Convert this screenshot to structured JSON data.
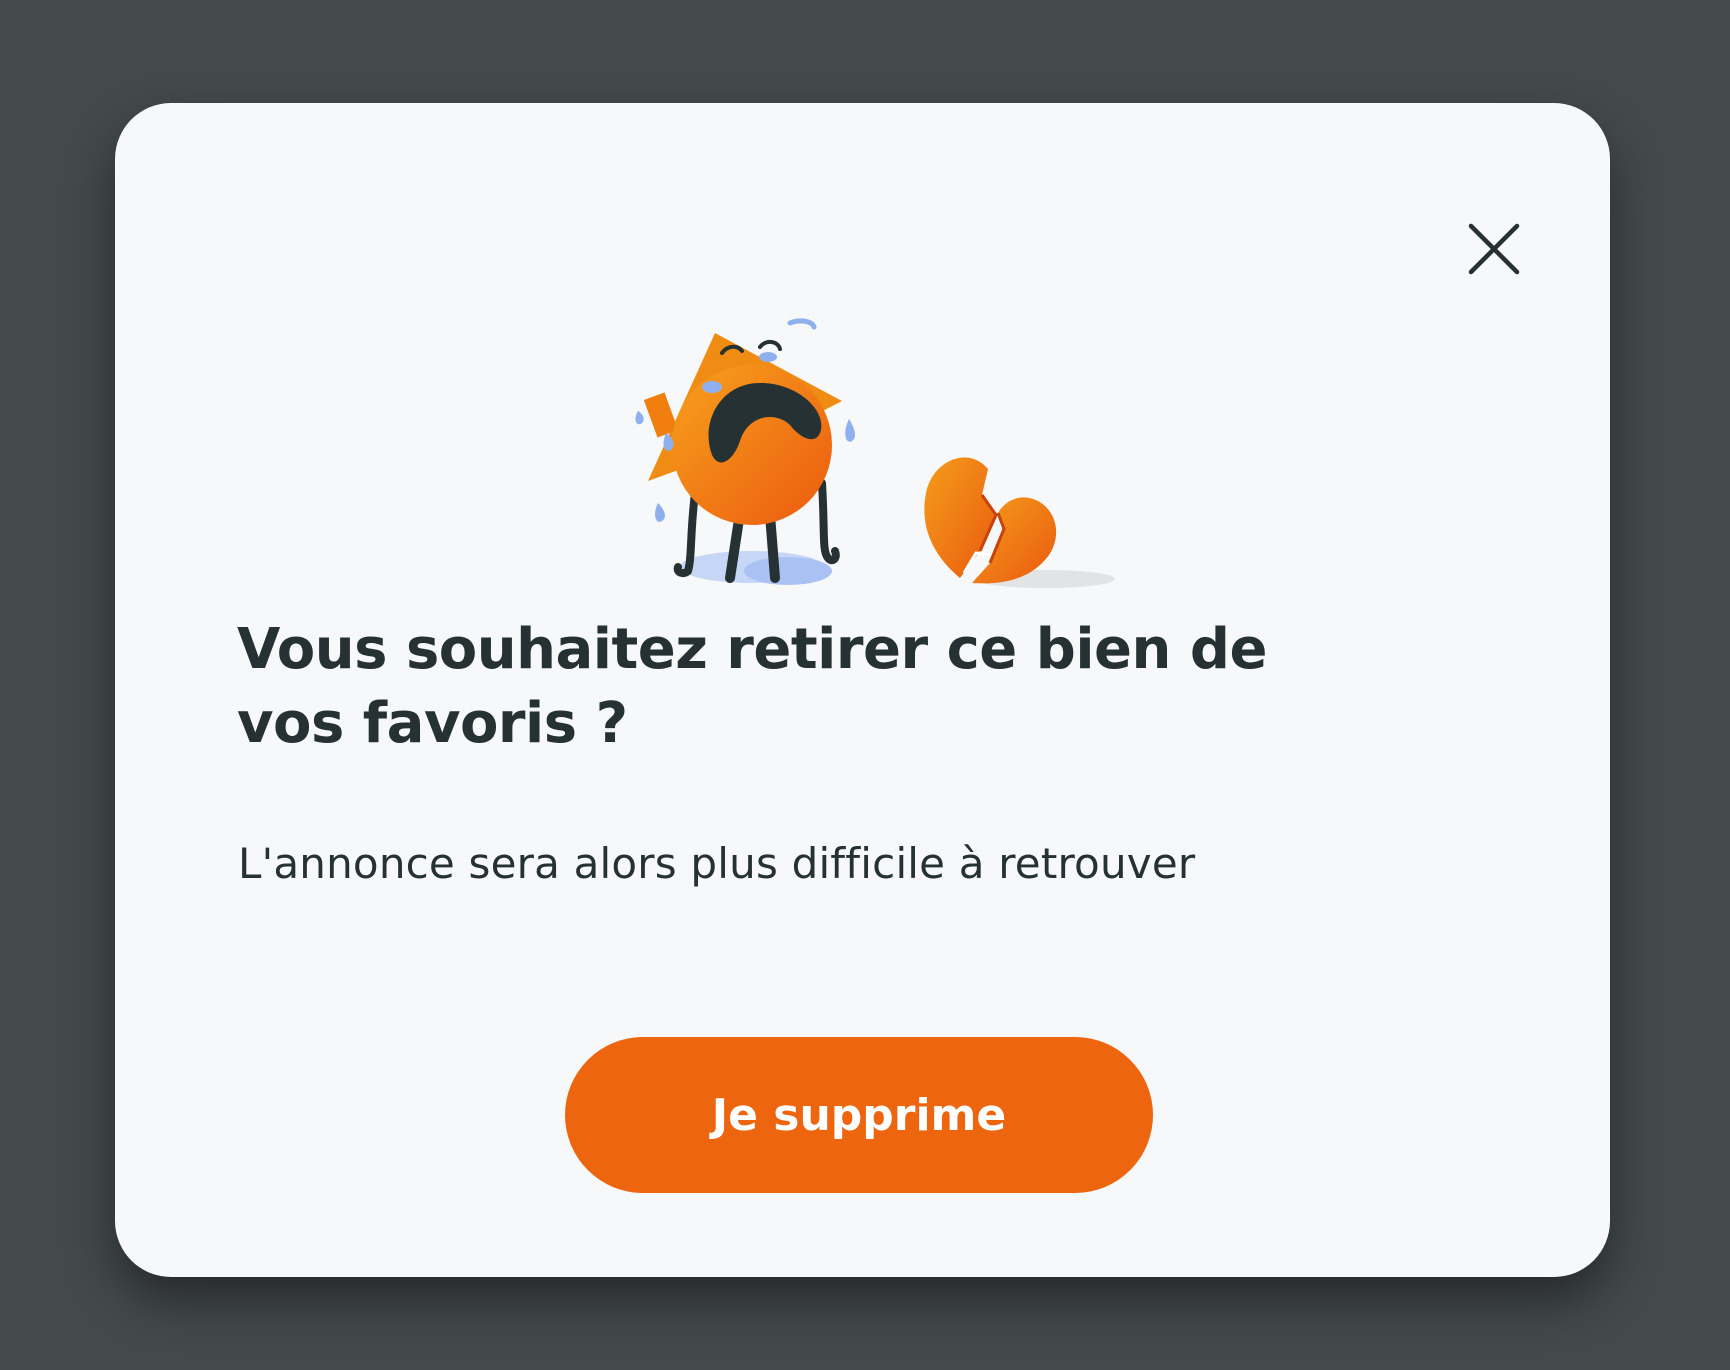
{
  "dialog": {
    "title": "Vous souhaitez retirer ce bien de vos favoris ?",
    "subtitle": "L'annonce sera alors plus difficile à retrouver",
    "confirm_label": "Je supprime",
    "close_icon": "close-icon",
    "illustration": "crying-house-broken-heart-illustration"
  },
  "colors": {
    "backdrop": "#444a4b",
    "surface": "#f6f8f9",
    "accent": "#ee650f",
    "text": "#263133"
  }
}
